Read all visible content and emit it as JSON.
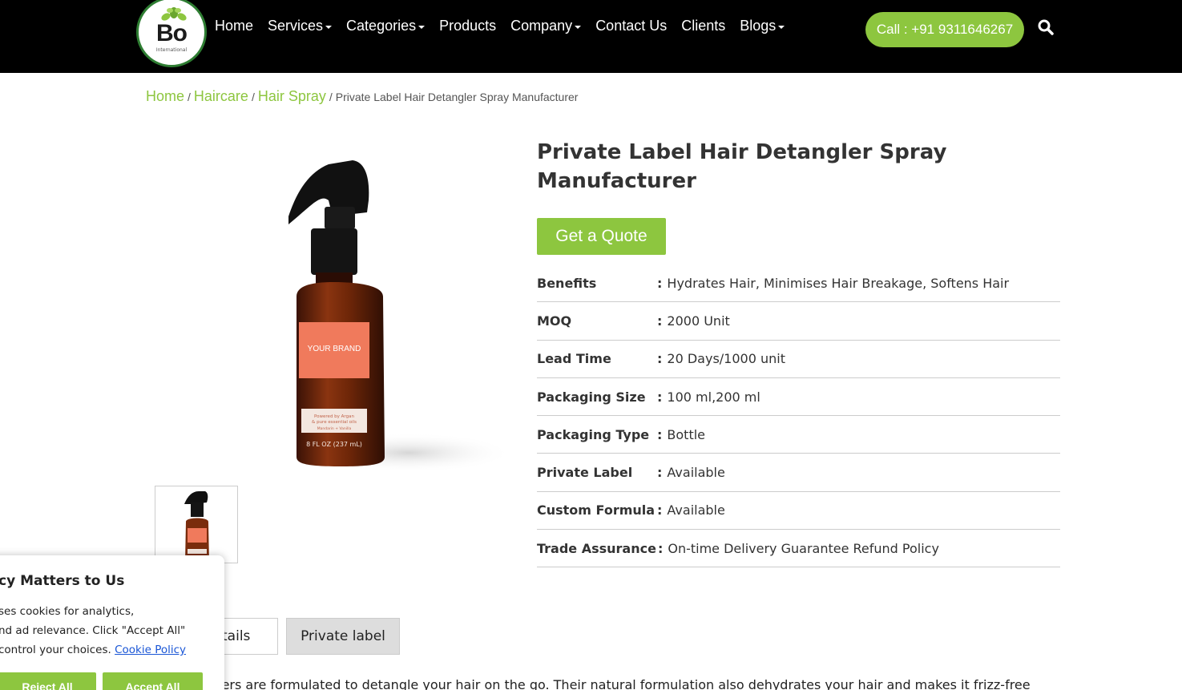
{
  "header": {
    "logo_text": "Bo",
    "logo_subtext": "International",
    "nav": [
      {
        "label": "Home",
        "dropdown": false
      },
      {
        "label": "Services",
        "dropdown": true
      },
      {
        "label": "Categories",
        "dropdown": true
      },
      {
        "label": "Products",
        "dropdown": false
      },
      {
        "label": "Company",
        "dropdown": true
      },
      {
        "label": "Contact Us",
        "dropdown": false
      },
      {
        "label": "Clients",
        "dropdown": false
      },
      {
        "label": "Blogs",
        "dropdown": true
      }
    ],
    "call_label": "Call : +91 9311646267",
    "search_icon": "search-icon"
  },
  "breadcrumb": {
    "items": [
      "Home",
      "Haircare",
      "Hair Spray"
    ],
    "separator": "/",
    "current": "Private Label Hair Detangler Spray Manufacturer"
  },
  "product": {
    "title": "Private Label Hair Detangler Spray Manufacturer",
    "quote_label": "Get a Quote",
    "image_label": {
      "brand": "YOUR BRAND",
      "line1": "Powered by Argan",
      "line2": "& pure essential oils",
      "line3": "Mandarin + Vanilla",
      "volume": "8 FL OZ (237 mL)"
    },
    "specs": [
      {
        "label": "Benefits",
        "value": "Hydrates Hair, Minimises Hair Breakage, Softens Hair"
      },
      {
        "label": "MOQ",
        "value": "2000 Unit"
      },
      {
        "label": "Lead Time",
        "value": "20 Days/1000 unit"
      },
      {
        "label": "Packaging Size",
        "value": "100 ml,200 ml"
      },
      {
        "label": "Packaging Type",
        "value": "Bottle"
      },
      {
        "label": "Private Label",
        "value": "Available"
      },
      {
        "label": "Custom Formula",
        "value": "Available"
      },
      {
        "label": "Trade Assurance",
        "value": "On-time Delivery Guarantee Refund Policy"
      }
    ]
  },
  "tabs": [
    {
      "label": "Details",
      "shown": "etails"
    },
    {
      "label": "Private label",
      "shown": "Private label"
    }
  ],
  "description": "ulers are formulated to detangle your hair on the go. Their natural formulation also dehydrates your hair and makes it frizz-free",
  "cookie": {
    "title": "cy Matters to Us",
    "line1": "ses cookies for analytics,",
    "line2": "nd ad relevance. Click \"Accept All\"",
    "line3": "control your choices.",
    "policy_link": "Cookie Policy",
    "reject_label": "Reject All",
    "accept_label": "Accept All"
  },
  "colors": {
    "accent": "#8dc63f",
    "header_bg": "#000000",
    "link_blue": "#1a56d6"
  }
}
